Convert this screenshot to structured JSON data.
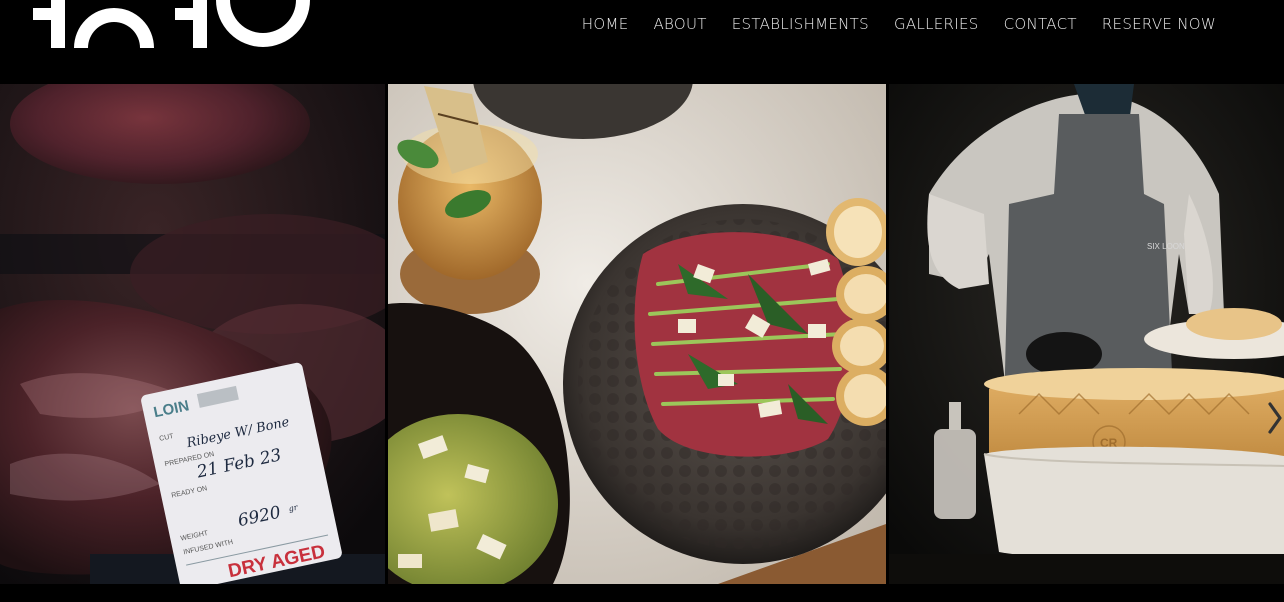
{
  "header": {
    "logo_text": "1010",
    "nav": [
      {
        "label": "HOME"
      },
      {
        "label": "ABOUT"
      },
      {
        "label": "ESTABLISHMENTS"
      },
      {
        "label": "GALLERIES"
      },
      {
        "label": "CONTACT"
      },
      {
        "label": "RESERVE NOW"
      }
    ]
  },
  "gallery": {
    "slides": [
      {
        "label_tag": {
          "brand": "LOIN",
          "cut_label": "CUT",
          "cut_value": "Ribeye W/ Bone",
          "prepared_label": "PREPARED ON",
          "prepared_value": "21 Feb 23",
          "ready_label": "READY ON",
          "weight_label": "WEIGHT",
          "weight_value": "6920",
          "weight_unit": "gr",
          "infused_label": "INFUSED WITH",
          "footer": "DRY AGED"
        }
      },
      {},
      {
        "apron_text": "SIX LOON",
        "wheel_text": "CR"
      }
    ],
    "next_icon": "chevron-right-icon"
  },
  "colors": {
    "background": "#000000",
    "nav_text": "#ececec"
  }
}
